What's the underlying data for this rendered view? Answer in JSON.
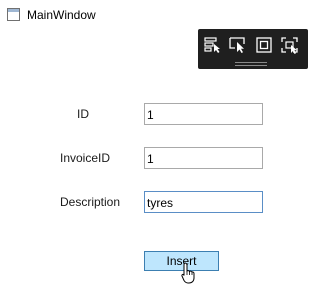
{
  "window": {
    "title": "MainWindow",
    "icon": "window-icon"
  },
  "toolbar": {
    "buttons": [
      {
        "icon": "select-visual-element-icon"
      },
      {
        "icon": "select-element-icon"
      },
      {
        "icon": "display-layout-adorners-icon"
      },
      {
        "icon": "track-focused-element-icon"
      }
    ]
  },
  "form": {
    "id": {
      "label": "ID",
      "value": "1"
    },
    "invoice_id": {
      "label": "InvoiceID",
      "value": "1"
    },
    "description": {
      "label": "Description",
      "value": "tyres"
    }
  },
  "insert_button": {
    "label": "Insert"
  },
  "colors": {
    "toolbar_bg": "#1f1f1f",
    "button_hover_bg": "#bee6fd",
    "button_hover_border": "#3c7fb1",
    "focused_border": "#5a8ec6"
  }
}
